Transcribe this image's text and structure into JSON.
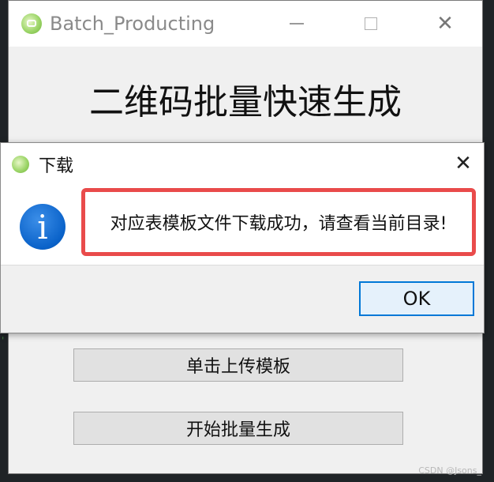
{
  "main_window": {
    "title": "Batch_Producting",
    "heading": "二维码批量快速生成",
    "buttons": {
      "upload_label": "单击上传模板",
      "generate_label": "开始批量生成"
    }
  },
  "dialog": {
    "title": "下载",
    "message": "对应表模板文件下载成功，请查看当前目录!",
    "ok_label": "OK"
  },
  "watermark": "CSDN @Jsons_",
  "colors": {
    "message_border": "#e94b4b",
    "ok_border": "#0078d7",
    "info_icon": "#0a62c9"
  },
  "icons": {
    "close": "✕",
    "info": "i"
  }
}
